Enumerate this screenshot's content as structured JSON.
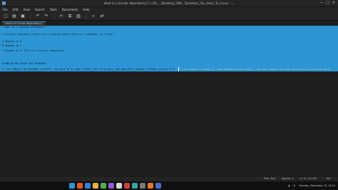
{
  "window": {
    "title": "what is a circular dependency? (~/Dr_.../Desktop/_SW/...Questions_You_Have_To_Linux) - ...",
    "controls": [
      "—",
      "□",
      "✕"
    ]
  },
  "menu": [
    "File",
    "Edit",
    "View",
    "Search",
    "Tools",
    "Documents",
    "Help"
  ],
  "toolbar": {
    "icons": [
      "new-file-icon",
      "open-file-icon",
      "save-icon",
      "undo-icon",
      "redo-icon",
      "cut-icon",
      "copy-icon",
      "paste-icon",
      "search-icon",
      "replace-icon"
    ],
    "glyphs": [
      "▢",
      "▤",
      "▣",
      "↶",
      "↷",
      "✂",
      "⧉",
      "▥",
      "⌕",
      "⇄"
    ]
  },
  "tab": {
    "label": "what is a circular dependency?"
  },
  "editor": {
    "lines": [
      "# WHAT IS A CIRCULAR DEPENDENCY?",
      "",
      "A circular dependency refers to a situation where there are 2 packages, A, B and C",
      "",
      "A depends on B",
      "",
      "B depends on C",
      "",
      "C depends on A. This is a circular dependency.",
      "",
      "",
      "# HOW DO YOU SOLVE THIS PROBLEM?"
    ],
    "last_selected": "If you compile the packages yourself, you have to do some trickery for it to work, you basically compile a broken version of A",
    "last_rest": ", then compile C using it, then compile B using that C, and then compile the real version of A using the new B"
  },
  "status": {
    "left": "",
    "syntax": "Plain Text",
    "tab_width": "Spaces: 4",
    "position": "Ln 13, Col 245",
    "mode": "INS"
  },
  "taskbar": {
    "dock_colors": [
      "#2d95d3",
      "#e2572c",
      "#3b7fd6",
      "#e8b341",
      "#4fae4f",
      "#8a5fd1",
      "#d9d9d9",
      "#cc3f3f",
      "#3aa6a6",
      "#7a7a7a",
      "#e07b2d",
      "#4b6cc7"
    ],
    "tray_time": "Tuesday, December 13, 14:24"
  }
}
